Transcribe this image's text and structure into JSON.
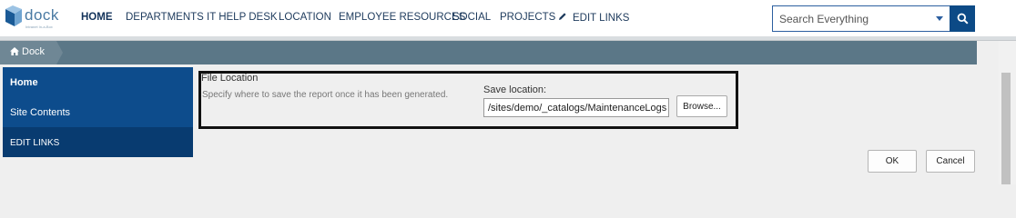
{
  "brand": {
    "name": "dock",
    "tagline": "Intranet In-a-Box"
  },
  "nav": {
    "items": [
      {
        "label": "HOME"
      },
      {
        "label": "DEPARTMENTS"
      },
      {
        "label": "IT HELP DESK"
      },
      {
        "label": "LOCATION"
      },
      {
        "label": "EMPLOYEE RESOURCES"
      },
      {
        "label": "SOCIAL"
      },
      {
        "label": "PROJECTS"
      }
    ],
    "edit_links_label": "EDIT LINKS"
  },
  "search": {
    "placeholder": "Search Everything"
  },
  "breadcrumb": {
    "label": "Dock"
  },
  "quicklaunch": {
    "items": [
      {
        "label": "Home"
      },
      {
        "label": "Site Contents"
      }
    ],
    "edit_links_label": "EDIT LINKS"
  },
  "file_location": {
    "title": "File Location",
    "description": "Specify where to save the report once it has been generated.",
    "save_label": "Save location:",
    "save_value": "/sites/demo/_catalogs/MaintenanceLogs",
    "browse_label": "Browse..."
  },
  "dialog": {
    "ok_label": "OK",
    "cancel_label": "Cancel"
  },
  "colors": {
    "nav_blue": "#0d4c8c",
    "breadcrumb_gray": "#5b7787",
    "search_button": "#0c4a86"
  }
}
